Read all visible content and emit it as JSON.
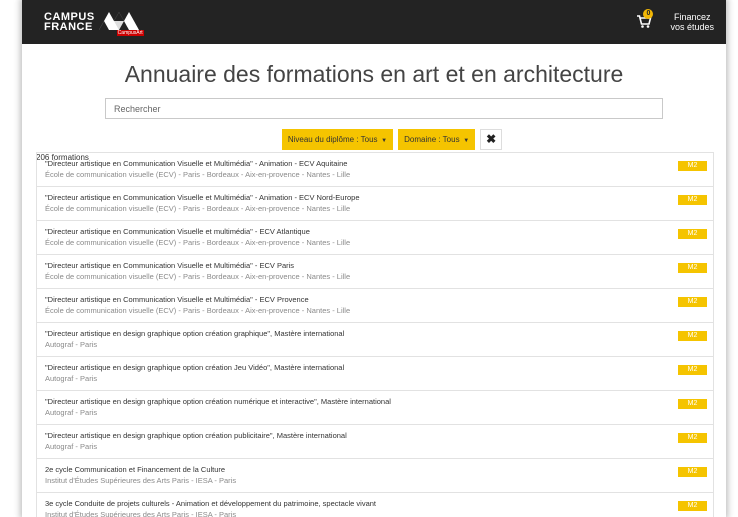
{
  "header": {
    "logo_line1": "CAMPUS",
    "logo_line2": "FRANCE",
    "logo_sub": "CampusArt",
    "cart_count": "0",
    "financez_line1": "Financez",
    "financez_line2": "vos études"
  },
  "page": {
    "title": "Annuaire des formations en art et en architecture",
    "search_placeholder": "Rechercher",
    "filter_niveau": "Niveau du diplôme : Tous",
    "filter_domaine": "Domaine : Tous",
    "clear": "✖",
    "count": "206 formations"
  },
  "items": [
    {
      "title": "\"Directeur artistique en Communication Visuelle et Multimédia\" - Animation - ECV Aquitaine",
      "sub": "École de communication visuelle (ECV) - Paris - Bordeaux - Aix-en-provence - Nantes - Lille",
      "badge": "M2"
    },
    {
      "title": "\"Directeur artistique en Communication Visuelle et Multimédia\" - Animation - ECV Nord-Europe",
      "sub": "École de communication visuelle (ECV) - Paris - Bordeaux - Aix-en-provence - Nantes - Lille",
      "badge": "M2"
    },
    {
      "title": "\"Directeur artistique en Communication Visuelle et multimédia\" - ECV Atlantique",
      "sub": "École de communication visuelle (ECV) - Paris - Bordeaux - Aix-en-provence - Nantes - Lille",
      "badge": "M2"
    },
    {
      "title": "\"Directeur artistique en Communication Visuelle et Multimédia\" - ECV Paris",
      "sub": "École de communication visuelle (ECV) - Paris - Bordeaux - Aix-en-provence - Nantes - Lille",
      "badge": "M2"
    },
    {
      "title": "\"Directeur artistique en Communication Visuelle et Multimédia\" - ECV Provence",
      "sub": "École de communication visuelle (ECV) - Paris - Bordeaux - Aix-en-provence - Nantes - Lille",
      "badge": "M2"
    },
    {
      "title": "\"Directeur artistique en design graphique option création graphique\", Mastère international",
      "sub": "Autograf - Paris",
      "badge": "M2"
    },
    {
      "title": "\"Directeur artistique en design graphique option création Jeu Vidéo\", Mastère international",
      "sub": "Autograf - Paris",
      "badge": "M2"
    },
    {
      "title": "\"Directeur artistique en design graphique option création numérique et interactive\", Mastère international",
      "sub": "Autograf - Paris",
      "badge": "M2"
    },
    {
      "title": "\"Directeur artistique en design graphique option création publicitaire\", Mastère international",
      "sub": "Autograf - Paris",
      "badge": "M2"
    },
    {
      "title": "2e cycle Communication et Financement de la Culture",
      "sub": "Institut d'Études Supérieures des Arts Paris - IESA - Paris",
      "badge": "M2"
    },
    {
      "title": "3e cycle Conduite de projets culturels - Animation et développement du patrimoine, spectacle vivant",
      "sub": "Institut d'Études Supérieures des Arts Paris - IESA - Paris",
      "badge": "M2"
    }
  ]
}
